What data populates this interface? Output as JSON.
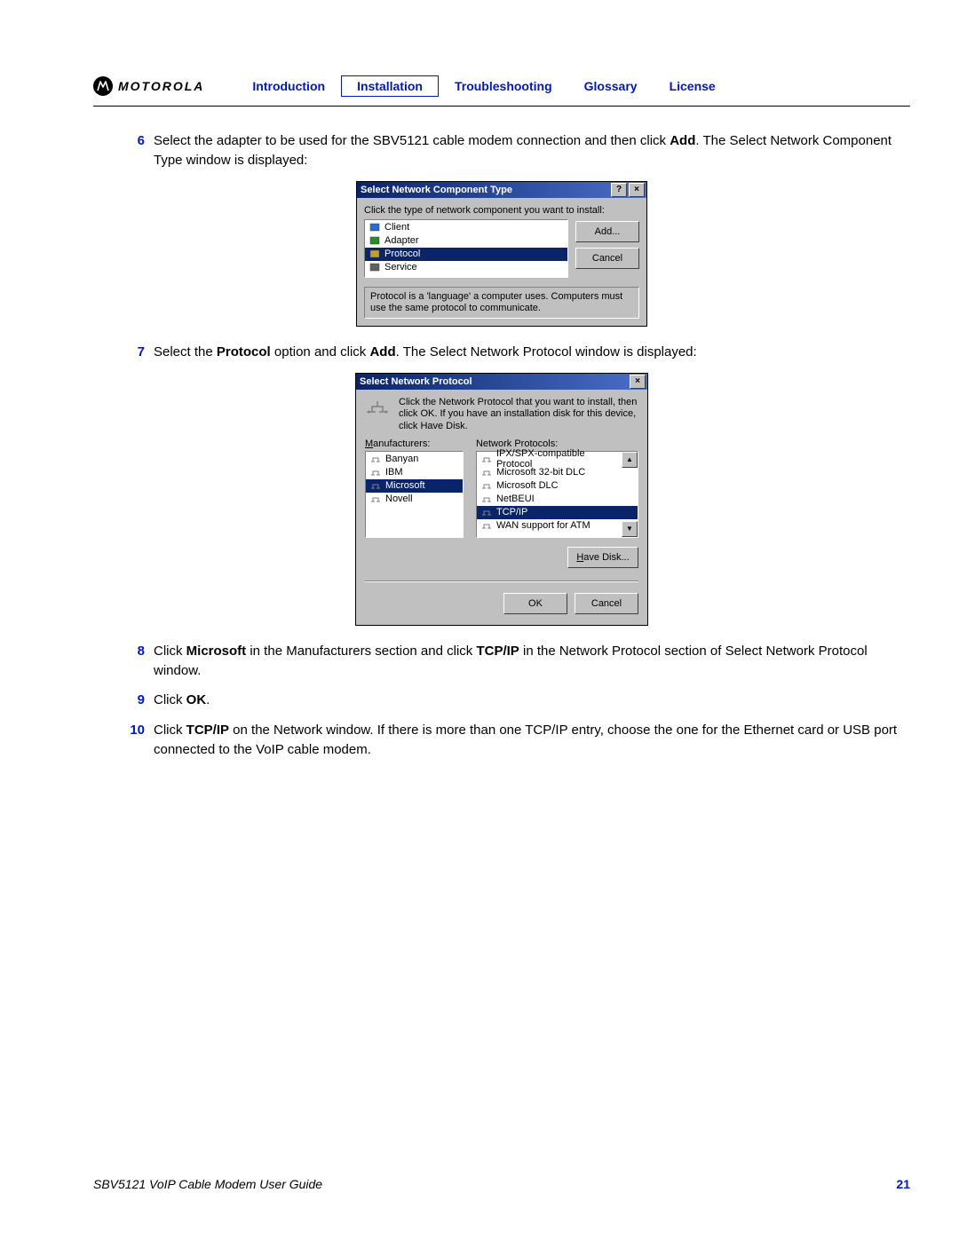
{
  "header": {
    "logo_text": "MOTOROLA",
    "nav": [
      "Introduction",
      "Installation",
      "Troubleshooting",
      "Glossary",
      "License"
    ],
    "active_index": 1
  },
  "steps": [
    {
      "num": "6",
      "parts": [
        {
          "t": "Select the adapter to be used for the SBV5121 cable modem connection and then click "
        },
        {
          "t": "Add",
          "b": true
        },
        {
          "t": ". The Select Network Component Type window is displayed:"
        }
      ]
    },
    {
      "num": "7",
      "parts": [
        {
          "t": "Select the "
        },
        {
          "t": "Protocol",
          "b": true
        },
        {
          "t": " option and click "
        },
        {
          "t": "Add",
          "b": true
        },
        {
          "t": ". The Select Network Protocol window is displayed:"
        }
      ]
    },
    {
      "num": "8",
      "parts": [
        {
          "t": "Click "
        },
        {
          "t": "Microsoft",
          "b": true
        },
        {
          "t": " in the Manufacturers section and click "
        },
        {
          "t": "TCP/IP",
          "b": true
        },
        {
          "t": " in the Network Protocol section of Select Network Protocol window."
        }
      ]
    },
    {
      "num": "9",
      "parts": [
        {
          "t": "Click "
        },
        {
          "t": "OK",
          "b": true
        },
        {
          "t": "."
        }
      ]
    },
    {
      "num": "10",
      "parts": [
        {
          "t": "Click "
        },
        {
          "t": "TCP/IP",
          "b": true
        },
        {
          "t": " on the Network window. If there is more than one TCP/IP entry, choose the one for the Ethernet card or USB port connected to the VoIP cable modem."
        }
      ]
    }
  ],
  "dialog1": {
    "title": "Select Network Component Type",
    "prompt": "Click the type of network component you want to install:",
    "items": [
      {
        "label": "Client"
      },
      {
        "label": "Adapter"
      },
      {
        "label": "Protocol",
        "selected": true
      },
      {
        "label": "Service"
      }
    ],
    "add_btn": "Add...",
    "cancel_btn": "Cancel",
    "description": "Protocol is a 'language' a computer uses. Computers must use the same protocol to communicate."
  },
  "dialog2": {
    "title": "Select Network Protocol",
    "message": "Click the Network Protocol that you want to install, then click OK. If you have an installation disk for this device, click Have Disk.",
    "manuf_label": "Manufacturers:",
    "proto_label": "Network Protocols:",
    "manufacturers": [
      {
        "label": "Banyan"
      },
      {
        "label": "IBM"
      },
      {
        "label": "Microsoft",
        "selected": true
      },
      {
        "label": "Novell"
      }
    ],
    "protocols": [
      {
        "label": "IPX/SPX-compatible Protocol"
      },
      {
        "label": "Microsoft 32-bit DLC"
      },
      {
        "label": "Microsoft DLC"
      },
      {
        "label": "NetBEUI"
      },
      {
        "label": "TCP/IP",
        "selected": true
      },
      {
        "label": "WAN support for ATM"
      }
    ],
    "have_disk_btn": "Have Disk...",
    "ok_btn": "OK",
    "cancel_btn": "Cancel"
  },
  "footer": {
    "guide": "SBV5121 VoIP Cable Modem User Guide",
    "page": "21"
  }
}
